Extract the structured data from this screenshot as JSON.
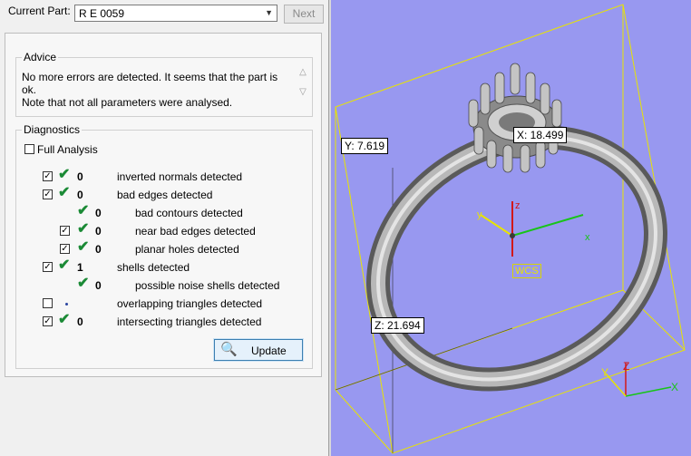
{
  "current_part": {
    "label": "Current Part:",
    "value": "R E 0059",
    "next_label": "Next"
  },
  "advice": {
    "title": "Advice",
    "line1": "No more errors are detected. It seems that the part is ok.",
    "line2": "Note that not all parameters were analysed."
  },
  "diagnostics": {
    "title": "Diagnostics",
    "full_analysis_label": "Full Analysis",
    "rows": [
      {
        "count": "0",
        "label": "inverted normals detected"
      },
      {
        "count": "0",
        "label": "bad edges detected"
      },
      {
        "count": "0",
        "label": "bad contours detected"
      },
      {
        "count": "0",
        "label": "near bad edges detected"
      },
      {
        "count": "0",
        "label": "planar holes detected"
      },
      {
        "count": "1",
        "label": "shells detected"
      },
      {
        "count": "0",
        "label": "possible noise shells detected"
      },
      {
        "count": "",
        "label": "overlapping triangles detected"
      },
      {
        "count": "0",
        "label": "intersecting triangles detected"
      }
    ],
    "update_label": "Update"
  },
  "viewport": {
    "x_readout": "X: 18.499",
    "y_readout": "Y: 7.619",
    "z_readout": "Z: 21.694",
    "wcs_label": "WCS",
    "axis_x": "x",
    "axis_y": "y",
    "axis_z": "z",
    "axis_X": "X",
    "axis_Y": "Y",
    "axis_Z": "Z",
    "background_color": "#9898f0",
    "bbox_color": "#e8e400"
  }
}
